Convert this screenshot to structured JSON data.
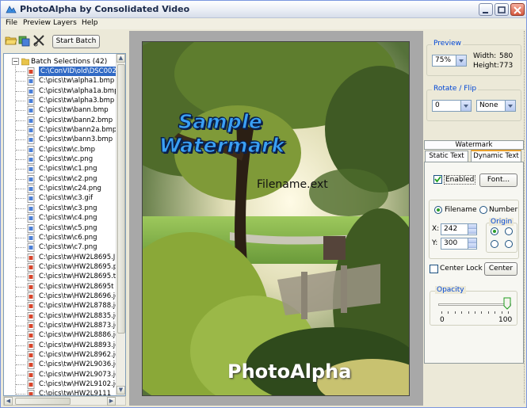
{
  "window": {
    "title": "PhotoAlpha by Consolidated Video"
  },
  "menu": [
    "File",
    "Preview",
    "Layers",
    "Help"
  ],
  "toolbar": {
    "start_batch": "Start Batch"
  },
  "tree": {
    "root_label": "Batch Selections (42)",
    "items": [
      "C:\\ConVID\\old\\DSC002",
      "C:\\pics\\tw\\alpha1.bmp",
      "C:\\pics\\tw\\alpha1a.bmp",
      "C:\\pics\\tw\\alpha3.bmp",
      "C:\\pics\\tw\\bann.bmp",
      "C:\\pics\\tw\\bann2.bmp",
      "C:\\pics\\tw\\bann2a.bmp",
      "C:\\pics\\tw\\bann3.bmp",
      "C:\\pics\\tw\\c.bmp",
      "C:\\pics\\tw\\c.png",
      "C:\\pics\\tw\\c1.png",
      "C:\\pics\\tw\\c2.png",
      "C:\\pics\\tw\\c24.png",
      "C:\\pics\\tw\\c3.gif",
      "C:\\pics\\tw\\c3.png",
      "C:\\pics\\tw\\c4.png",
      "C:\\pics\\tw\\c5.png",
      "C:\\pics\\tw\\c6.png",
      "C:\\pics\\tw\\c7.png",
      "C:\\pics\\tw\\HW2L8695.J",
      "C:\\pics\\tw\\HW2L8695.p",
      "C:\\pics\\tw\\HW2L8695.tif",
      "C:\\pics\\tw\\HW2L8695t",
      "C:\\pics\\tw\\HW2L8696.jc",
      "C:\\pics\\tw\\HW2L8788.jc",
      "C:\\pics\\tw\\HW2L8835.jc",
      "C:\\pics\\tw\\HW2L8873.jc",
      "C:\\pics\\tw\\HW2L8886.jc",
      "C:\\pics\\tw\\HW2L8893.jc",
      "C:\\pics\\tw\\HW2L8962.jc",
      "C:\\pics\\tw\\HW2L9036.jc",
      "C:\\pics\\tw\\HW2L9073.jc",
      "C:\\pics\\tw\\HW2L9102.jc",
      "C:\\pics\\tw\\HW2L9111"
    ]
  },
  "preview_image": {
    "watermark_line1": "Sample",
    "watermark_line2": "Watermark",
    "filename_text": "Filename.ext",
    "brand_text": "PhotoAlpha"
  },
  "preview_group": {
    "title": "Preview",
    "zoom": "75%",
    "width_label": "Width:",
    "width_value": "580",
    "height_label": "Height:",
    "height_value": "773"
  },
  "rotate_group": {
    "title": "Rotate / Flip",
    "rotate_value": "0",
    "flip_value": "None"
  },
  "watermark_panel": {
    "header": "Watermark",
    "tab_static": "Static Text",
    "tab_dynamic": "Dynamic Text",
    "enabled_label": "Enabled",
    "font_button": "Font...",
    "filename_radio": "Filename",
    "number_radio": "Number",
    "origin_label": "Origin",
    "x_label": "X:",
    "x_value": "242",
    "y_label": "Y:",
    "y_value": "300",
    "center_lock_label": "Center Lock",
    "center_button": "Center",
    "opacity_label": "Opacity",
    "opacity_min": "0",
    "opacity_max": "100",
    "opacity_value": 100
  },
  "colors": {
    "selection": "#316ac5",
    "group_title": "#0046d5",
    "watermark_text": "#3aa0f5"
  }
}
